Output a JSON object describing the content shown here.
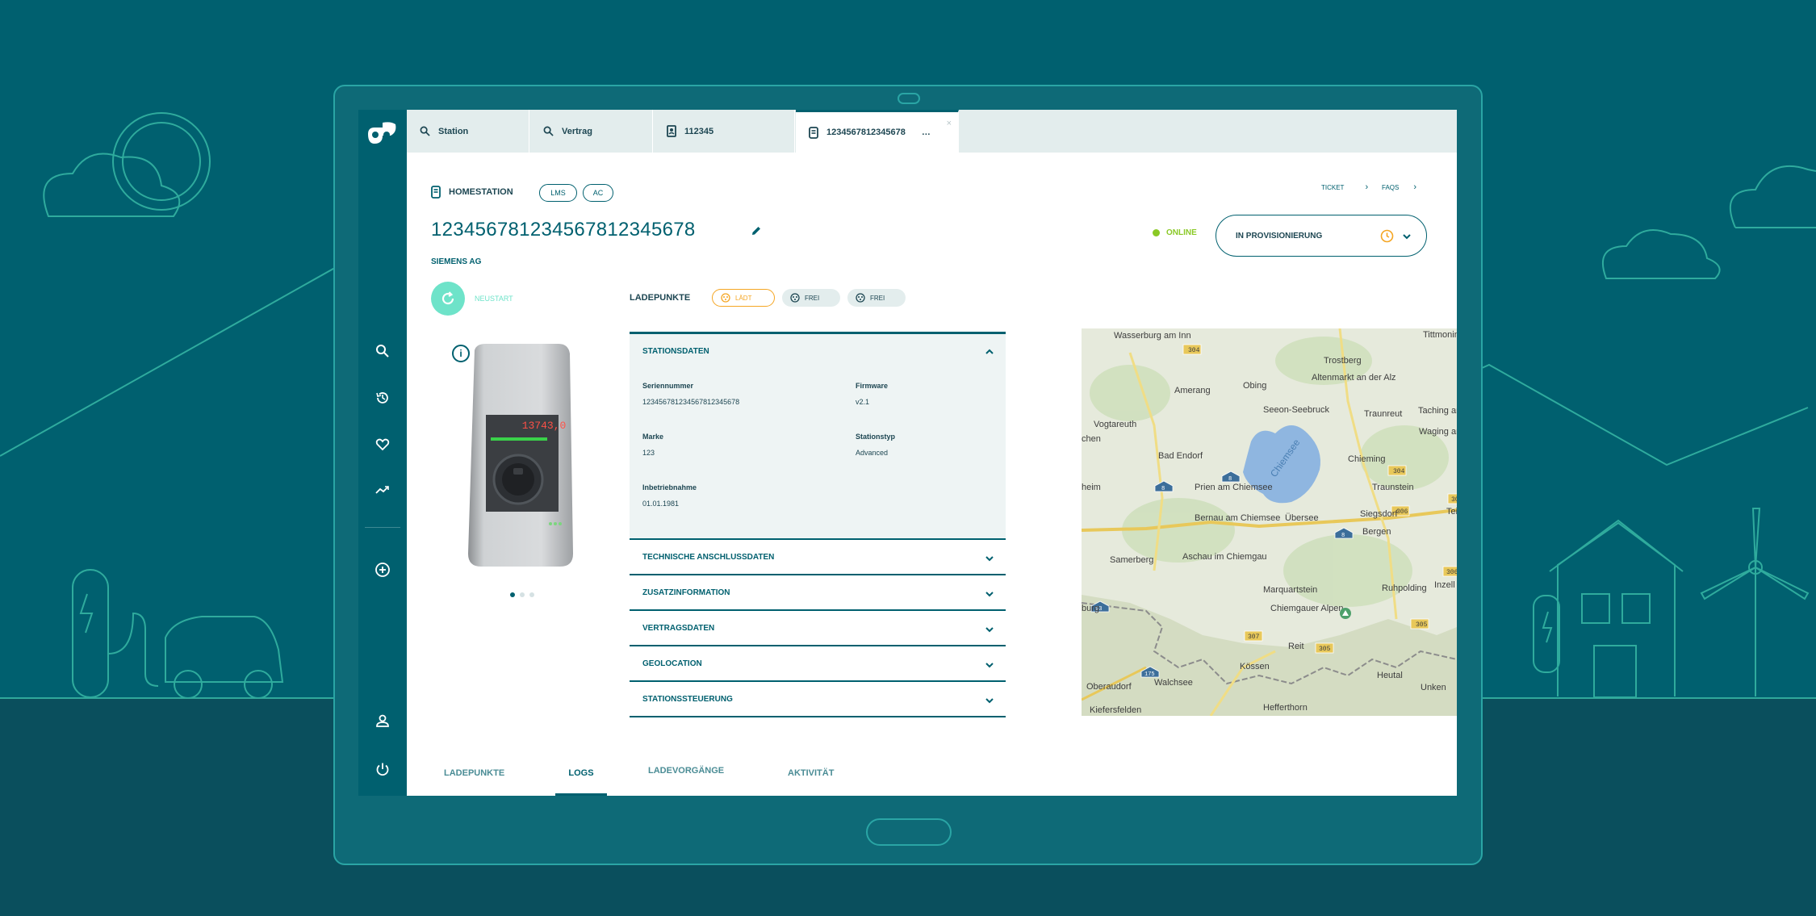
{
  "tabs": [
    {
      "label": "Station",
      "icon": "search-icon"
    },
    {
      "label": "Vertrag",
      "icon": "search-icon"
    },
    {
      "label": "112345",
      "icon": "contract-icon"
    },
    {
      "label": "1234567812345678",
      "ellipsis": "…",
      "close": "×",
      "icon": "station-icon"
    }
  ],
  "header": {
    "type_label": "HOMESTATION",
    "pills": [
      "LMS",
      "AC"
    ],
    "title": "123456781234567812345678",
    "company": "SIEMENS AG",
    "links": [
      {
        "label": "TICKET",
        "chevron": "›"
      },
      {
        "label": "FAQS",
        "chevron": "›"
      }
    ],
    "online_label": "ONLINE",
    "provisioning_label": "IN PROVISIONIERUNG"
  },
  "neustart_label": "NEUSTART",
  "charger_display": "13743,0",
  "ladepunkte": {
    "label": "LADEPUNKTE",
    "items": [
      {
        "label": "LÄDT",
        "state": "laedt"
      },
      {
        "label": "FREI",
        "state": "frei"
      },
      {
        "label": "FREI",
        "state": "frei"
      }
    ]
  },
  "accordion": {
    "open_section": {
      "title": "STATIONSDATEN",
      "fields": [
        {
          "label": "Seriennummer",
          "value": "123456781234567812345678"
        },
        {
          "label": "Firmware",
          "value": "v2.1"
        },
        {
          "label": "Marke",
          "value": "123"
        },
        {
          "label": "Stationstyp",
          "value": "Advanced"
        },
        {
          "label": "Inbetriebnahme",
          "value": "01.01.1981"
        }
      ]
    },
    "sections": [
      "TECHNISCHE ANSCHLUSSDATEN",
      "ZUSATZINFORMATION",
      "VERTRAGSDATEN",
      "GEOLOCATION",
      "STATIONSSTEUERUNG"
    ]
  },
  "map": {
    "lake_label": "Chiemsee",
    "places": [
      "Wasserburg am Inn",
      "Trostberg",
      "Tittmoning",
      "Amerang",
      "Obing",
      "Altenmarkt an der Alz",
      "Seeon-Seebruck",
      "Traunreut",
      "Taching am See",
      "Waging am See",
      "Vogtareuth",
      "Bad Endorf",
      "Chieming",
      "Prien am Chiemsee",
      "Traunstein",
      "Bernau am Chiemsee",
      "Übersee",
      "Siegsdorf",
      "Bergen",
      "Samerberg",
      "Aschau im Chiemgau",
      "Marquartstein",
      "Ruhpolding",
      "Inzell",
      "Chiemgauer Alpen",
      "Reit",
      "Kössen",
      "Walchsee",
      "Heutal",
      "Unken",
      "Oberaudorf",
      "Kiefersfelden",
      "Hefferthorn",
      "heim",
      "chen",
      "burg",
      "Tei"
    ],
    "road_badges": [
      {
        "label": "304",
        "kind": "state"
      },
      {
        "label": "304",
        "kind": "state"
      },
      {
        "label": "304",
        "kind": "state"
      },
      {
        "label": "306",
        "kind": "state"
      },
      {
        "label": "306",
        "kind": "state"
      },
      {
        "label": "305",
        "kind": "state"
      },
      {
        "label": "305",
        "kind": "state"
      },
      {
        "label": "307",
        "kind": "state"
      },
      {
        "label": "8",
        "kind": "autobahn"
      },
      {
        "label": "8",
        "kind": "autobahn"
      },
      {
        "label": "8",
        "kind": "autobahn"
      },
      {
        "label": "93",
        "kind": "autobahn"
      },
      {
        "label": "175",
        "kind": "autobahn"
      }
    ]
  },
  "bottom_tabs": [
    "LADEPUNKTE",
    "LOGS",
    "LADEVORGÄNGE",
    "AKTIVITÄT"
  ],
  "active_bottom_tab": "LOGS",
  "colors": {
    "primary": "#00606f",
    "accent_green": "#8ac926",
    "mint": "#6ee3c9",
    "orange": "#f5a623",
    "map_bg": "#e6eadc"
  }
}
